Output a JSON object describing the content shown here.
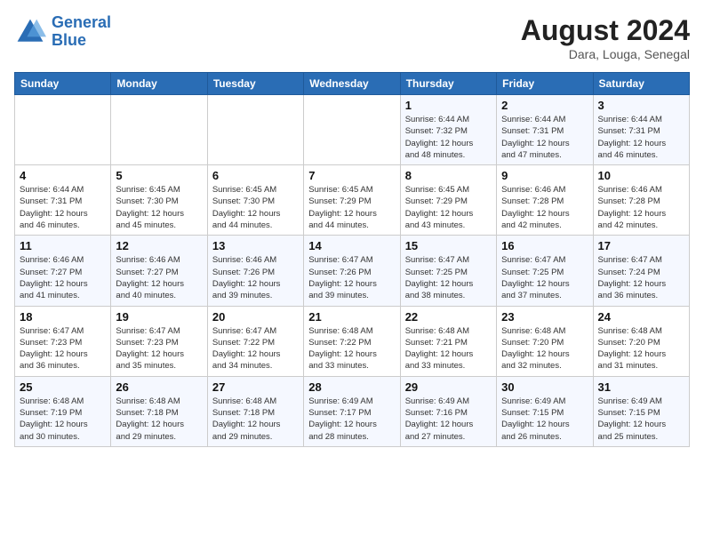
{
  "header": {
    "logo_line1": "General",
    "logo_line2": "Blue",
    "month_year": "August 2024",
    "location": "Dara, Louga, Senegal"
  },
  "weekdays": [
    "Sunday",
    "Monday",
    "Tuesday",
    "Wednesday",
    "Thursday",
    "Friday",
    "Saturday"
  ],
  "weeks": [
    [
      {
        "day": "",
        "info": ""
      },
      {
        "day": "",
        "info": ""
      },
      {
        "day": "",
        "info": ""
      },
      {
        "day": "",
        "info": ""
      },
      {
        "day": "1",
        "info": "Sunrise: 6:44 AM\nSunset: 7:32 PM\nDaylight: 12 hours\nand 48 minutes."
      },
      {
        "day": "2",
        "info": "Sunrise: 6:44 AM\nSunset: 7:31 PM\nDaylight: 12 hours\nand 47 minutes."
      },
      {
        "day": "3",
        "info": "Sunrise: 6:44 AM\nSunset: 7:31 PM\nDaylight: 12 hours\nand 46 minutes."
      }
    ],
    [
      {
        "day": "4",
        "info": "Sunrise: 6:44 AM\nSunset: 7:31 PM\nDaylight: 12 hours\nand 46 minutes."
      },
      {
        "day": "5",
        "info": "Sunrise: 6:45 AM\nSunset: 7:30 PM\nDaylight: 12 hours\nand 45 minutes."
      },
      {
        "day": "6",
        "info": "Sunrise: 6:45 AM\nSunset: 7:30 PM\nDaylight: 12 hours\nand 44 minutes."
      },
      {
        "day": "7",
        "info": "Sunrise: 6:45 AM\nSunset: 7:29 PM\nDaylight: 12 hours\nand 44 minutes."
      },
      {
        "day": "8",
        "info": "Sunrise: 6:45 AM\nSunset: 7:29 PM\nDaylight: 12 hours\nand 43 minutes."
      },
      {
        "day": "9",
        "info": "Sunrise: 6:46 AM\nSunset: 7:28 PM\nDaylight: 12 hours\nand 42 minutes."
      },
      {
        "day": "10",
        "info": "Sunrise: 6:46 AM\nSunset: 7:28 PM\nDaylight: 12 hours\nand 42 minutes."
      }
    ],
    [
      {
        "day": "11",
        "info": "Sunrise: 6:46 AM\nSunset: 7:27 PM\nDaylight: 12 hours\nand 41 minutes."
      },
      {
        "day": "12",
        "info": "Sunrise: 6:46 AM\nSunset: 7:27 PM\nDaylight: 12 hours\nand 40 minutes."
      },
      {
        "day": "13",
        "info": "Sunrise: 6:46 AM\nSunset: 7:26 PM\nDaylight: 12 hours\nand 39 minutes."
      },
      {
        "day": "14",
        "info": "Sunrise: 6:47 AM\nSunset: 7:26 PM\nDaylight: 12 hours\nand 39 minutes."
      },
      {
        "day": "15",
        "info": "Sunrise: 6:47 AM\nSunset: 7:25 PM\nDaylight: 12 hours\nand 38 minutes."
      },
      {
        "day": "16",
        "info": "Sunrise: 6:47 AM\nSunset: 7:25 PM\nDaylight: 12 hours\nand 37 minutes."
      },
      {
        "day": "17",
        "info": "Sunrise: 6:47 AM\nSunset: 7:24 PM\nDaylight: 12 hours\nand 36 minutes."
      }
    ],
    [
      {
        "day": "18",
        "info": "Sunrise: 6:47 AM\nSunset: 7:23 PM\nDaylight: 12 hours\nand 36 minutes."
      },
      {
        "day": "19",
        "info": "Sunrise: 6:47 AM\nSunset: 7:23 PM\nDaylight: 12 hours\nand 35 minutes."
      },
      {
        "day": "20",
        "info": "Sunrise: 6:47 AM\nSunset: 7:22 PM\nDaylight: 12 hours\nand 34 minutes."
      },
      {
        "day": "21",
        "info": "Sunrise: 6:48 AM\nSunset: 7:22 PM\nDaylight: 12 hours\nand 33 minutes."
      },
      {
        "day": "22",
        "info": "Sunrise: 6:48 AM\nSunset: 7:21 PM\nDaylight: 12 hours\nand 33 minutes."
      },
      {
        "day": "23",
        "info": "Sunrise: 6:48 AM\nSunset: 7:20 PM\nDaylight: 12 hours\nand 32 minutes."
      },
      {
        "day": "24",
        "info": "Sunrise: 6:48 AM\nSunset: 7:20 PM\nDaylight: 12 hours\nand 31 minutes."
      }
    ],
    [
      {
        "day": "25",
        "info": "Sunrise: 6:48 AM\nSunset: 7:19 PM\nDaylight: 12 hours\nand 30 minutes."
      },
      {
        "day": "26",
        "info": "Sunrise: 6:48 AM\nSunset: 7:18 PM\nDaylight: 12 hours\nand 29 minutes."
      },
      {
        "day": "27",
        "info": "Sunrise: 6:48 AM\nSunset: 7:18 PM\nDaylight: 12 hours\nand 29 minutes."
      },
      {
        "day": "28",
        "info": "Sunrise: 6:49 AM\nSunset: 7:17 PM\nDaylight: 12 hours\nand 28 minutes."
      },
      {
        "day": "29",
        "info": "Sunrise: 6:49 AM\nSunset: 7:16 PM\nDaylight: 12 hours\nand 27 minutes."
      },
      {
        "day": "30",
        "info": "Sunrise: 6:49 AM\nSunset: 7:15 PM\nDaylight: 12 hours\nand 26 minutes."
      },
      {
        "day": "31",
        "info": "Sunrise: 6:49 AM\nSunset: 7:15 PM\nDaylight: 12 hours\nand 25 minutes."
      }
    ]
  ]
}
